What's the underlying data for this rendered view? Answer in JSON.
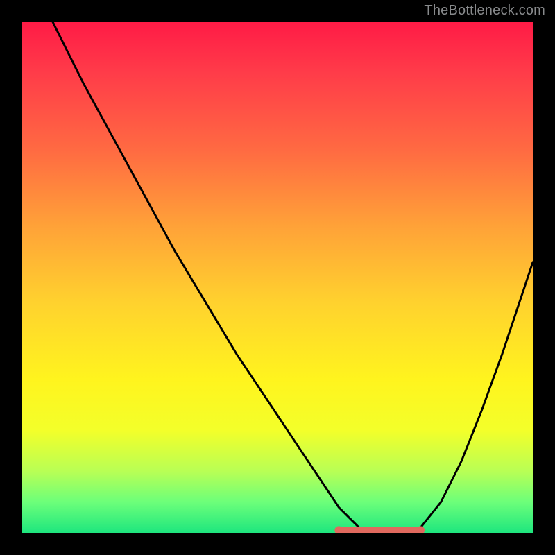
{
  "watermark": "TheBottleneck.com",
  "chart_data": {
    "type": "line",
    "title": "",
    "xlabel": "",
    "ylabel": "",
    "xlim": [
      0,
      100
    ],
    "ylim": [
      0,
      100
    ],
    "grid": false,
    "legend": false,
    "series": [
      {
        "name": "bottleneck-curve",
        "x": [
          0,
          6,
          12,
          18,
          24,
          30,
          36,
          42,
          48,
          54,
          58,
          62,
          66,
          70,
          74,
          78,
          82,
          86,
          90,
          94,
          98,
          100
        ],
        "values": [
          112,
          100,
          88,
          77,
          66,
          55,
          45,
          35,
          26,
          17,
          11,
          5,
          1,
          0,
          0,
          1,
          6,
          14,
          24,
          35,
          47,
          53
        ]
      }
    ],
    "highlight_band": {
      "name": "optimal-range",
      "x_start": 62,
      "x_end": 78,
      "y": 0.5,
      "color": "#e0695e"
    },
    "background_gradient": {
      "type": "vertical",
      "stops": [
        {
          "pos": 0.0,
          "color": "#ff1b46"
        },
        {
          "pos": 0.25,
          "color": "#ff6a42"
        },
        {
          "pos": 0.55,
          "color": "#ffd22e"
        },
        {
          "pos": 0.8,
          "color": "#f3ff2a"
        },
        {
          "pos": 1.0,
          "color": "#1ee67e"
        }
      ]
    }
  }
}
